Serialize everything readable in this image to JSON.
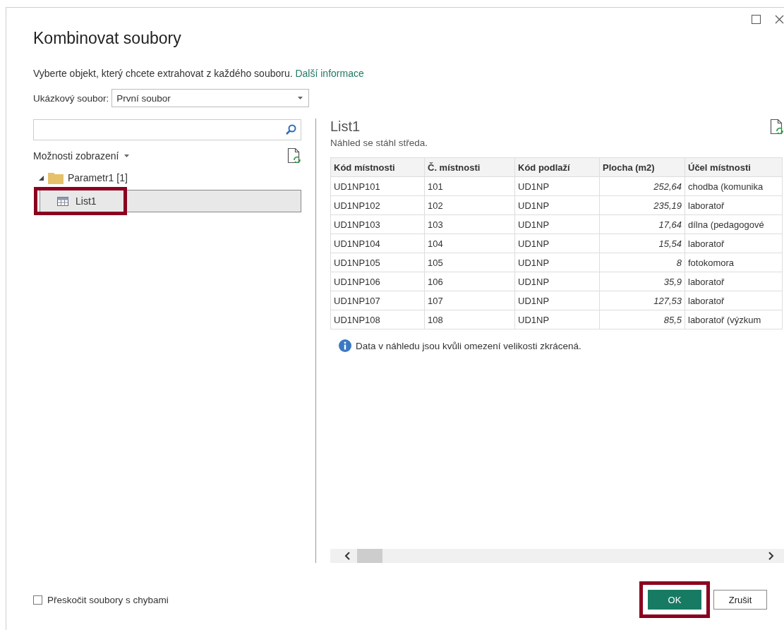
{
  "window": {
    "title": "Kombinovat soubory"
  },
  "description": {
    "text": "Vyberte objekt, který chcete extrahovat z každého souboru.",
    "link": "Další informace"
  },
  "sample_file": {
    "label": "Ukázkový soubor:",
    "value": "První soubor"
  },
  "view_options": {
    "label": "Možnosti zobrazení"
  },
  "tree": [
    {
      "label": "Parametr1 [1]",
      "expanded": true,
      "children": [
        {
          "label": "List1",
          "selected": true,
          "highlighted": true
        }
      ]
    }
  ],
  "preview": {
    "title": "List1",
    "subtitle": "Náhled se stáhl středa.",
    "columns": [
      {
        "label": "Kód místnosti",
        "kind": "text"
      },
      {
        "label": "Č. místnosti",
        "kind": "text"
      },
      {
        "label": "Kód podlaží",
        "kind": "text"
      },
      {
        "label": "Plocha (m2)",
        "kind": "number"
      },
      {
        "label": "Účel místnosti",
        "kind": "text"
      }
    ],
    "rows": [
      [
        "UD1NP101",
        "101",
        "UD1NP",
        "252,64",
        "chodba (komunika"
      ],
      [
        "UD1NP102",
        "102",
        "UD1NP",
        "235,19",
        "laboratoř"
      ],
      [
        "UD1NP103",
        "103",
        "UD1NP",
        "17,64",
        "dílna (pedagogové"
      ],
      [
        "UD1NP104",
        "104",
        "UD1NP",
        "15,54",
        "laboratoř"
      ],
      [
        "UD1NP105",
        "105",
        "UD1NP",
        "8",
        "fotokomora"
      ],
      [
        "UD1NP106",
        "106",
        "UD1NP",
        "35,9",
        "laboratoř"
      ],
      [
        "UD1NP107",
        "107",
        "UD1NP",
        "127,53",
        "laboratoř"
      ],
      [
        "UD1NP108",
        "108",
        "UD1NP",
        "85,5",
        "laboratoř (výzkum"
      ]
    ],
    "note": "Data v náhledu jsou kvůli omezení velikosti zkrácená."
  },
  "skip_errors": {
    "label": "Přeskočit soubory s chybami",
    "checked": false
  },
  "buttons": [
    {
      "label": "OK",
      "kind": "primary",
      "highlighted": true
    },
    {
      "label": "Zrušit",
      "kind": "secondary",
      "highlighted": false
    }
  ]
}
